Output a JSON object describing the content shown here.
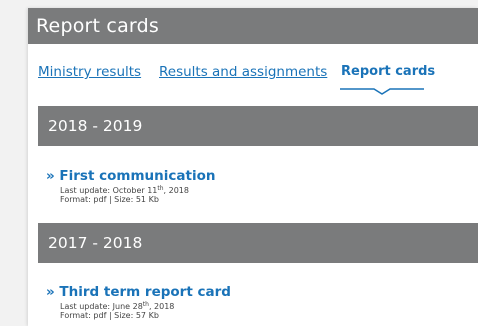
{
  "page": {
    "title": "Report cards"
  },
  "tabs": [
    {
      "label": "Ministry results"
    },
    {
      "label": "Results and assignments"
    },
    {
      "label": "Report cards",
      "active": true
    }
  ],
  "sections": [
    {
      "year": "2018 - 2019",
      "document": {
        "title": "» First communication",
        "update_prefix": "Last update: October 11",
        "update_suffix": "th",
        "update_year": ", 2018",
        "format_line": "Format: pdf | Size: 51 Kb"
      }
    },
    {
      "year": "2017 - 2018",
      "document": {
        "title": "» Third term report card",
        "update_prefix": "Last update: June 28",
        "update_suffix": "th",
        "update_year": ", 2018",
        "format_line": "Format: pdf | Size: 57 Kb"
      }
    }
  ],
  "colors": {
    "header_bg": "#7a7b7c",
    "link": "#1a73b8",
    "background": "#f2f2f2"
  }
}
